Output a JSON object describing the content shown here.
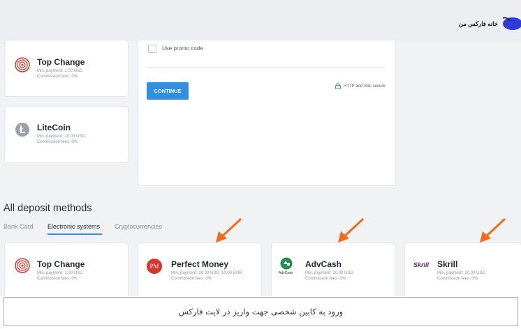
{
  "brand": {
    "name": "خانه فارکس من"
  },
  "top_methods": [
    {
      "name": "Top Change",
      "min_payment": "Min. payment: 1.00 USD",
      "commission": "Commission fees: 0%",
      "icon": "top-change-icon"
    },
    {
      "name": "LiteCoin",
      "min_payment": "Min. payment: 10.00 USD",
      "commission": "Commission fees: 0%",
      "icon": "litecoin-icon"
    }
  ],
  "payment_form": {
    "promo_label": "Use promo code",
    "continue_label": "CONTINUE",
    "secure_label": "HTTP and SSL secure"
  },
  "all_methods": {
    "title": "All deposit methods",
    "tabs": [
      "Bank Card",
      "Electronic systems",
      "Cryptocurrencies"
    ],
    "active_tab": "Electronic systems",
    "items": [
      {
        "name": "Top Change",
        "min_payment": "Min. payment: 1.00 USD",
        "commission": "Commission fees: 0%",
        "icon": "top-change-icon"
      },
      {
        "name": "Perfect Money",
        "min_payment": "Min. payment: 10.00 USD, 10.00 EUR",
        "commission": "Commission fees: 0%",
        "icon": "perfect-money-icon",
        "logo_text": "PM"
      },
      {
        "name": "AdvCash",
        "min_payment": "Min. payment: 10.00 USD",
        "commission": "Commission fees: 0%",
        "icon": "advcash-icon",
        "logo_text": "AdvCash"
      },
      {
        "name": "Skrill",
        "min_payment": "Min. payment: 10.00 USD",
        "commission": "Commission fees: 0%",
        "icon": "skrill-icon",
        "logo_text": "Skrill"
      }
    ]
  },
  "caption": "ورود به کابین شخصی جهت واریز در لایت فارکس",
  "colors": {
    "accent": "#2f8fe0",
    "arrow": "#f26b1d",
    "perfect_money": "#d9342b",
    "advcash": "#1f8f4e",
    "skrill": "#6b1f5c"
  }
}
